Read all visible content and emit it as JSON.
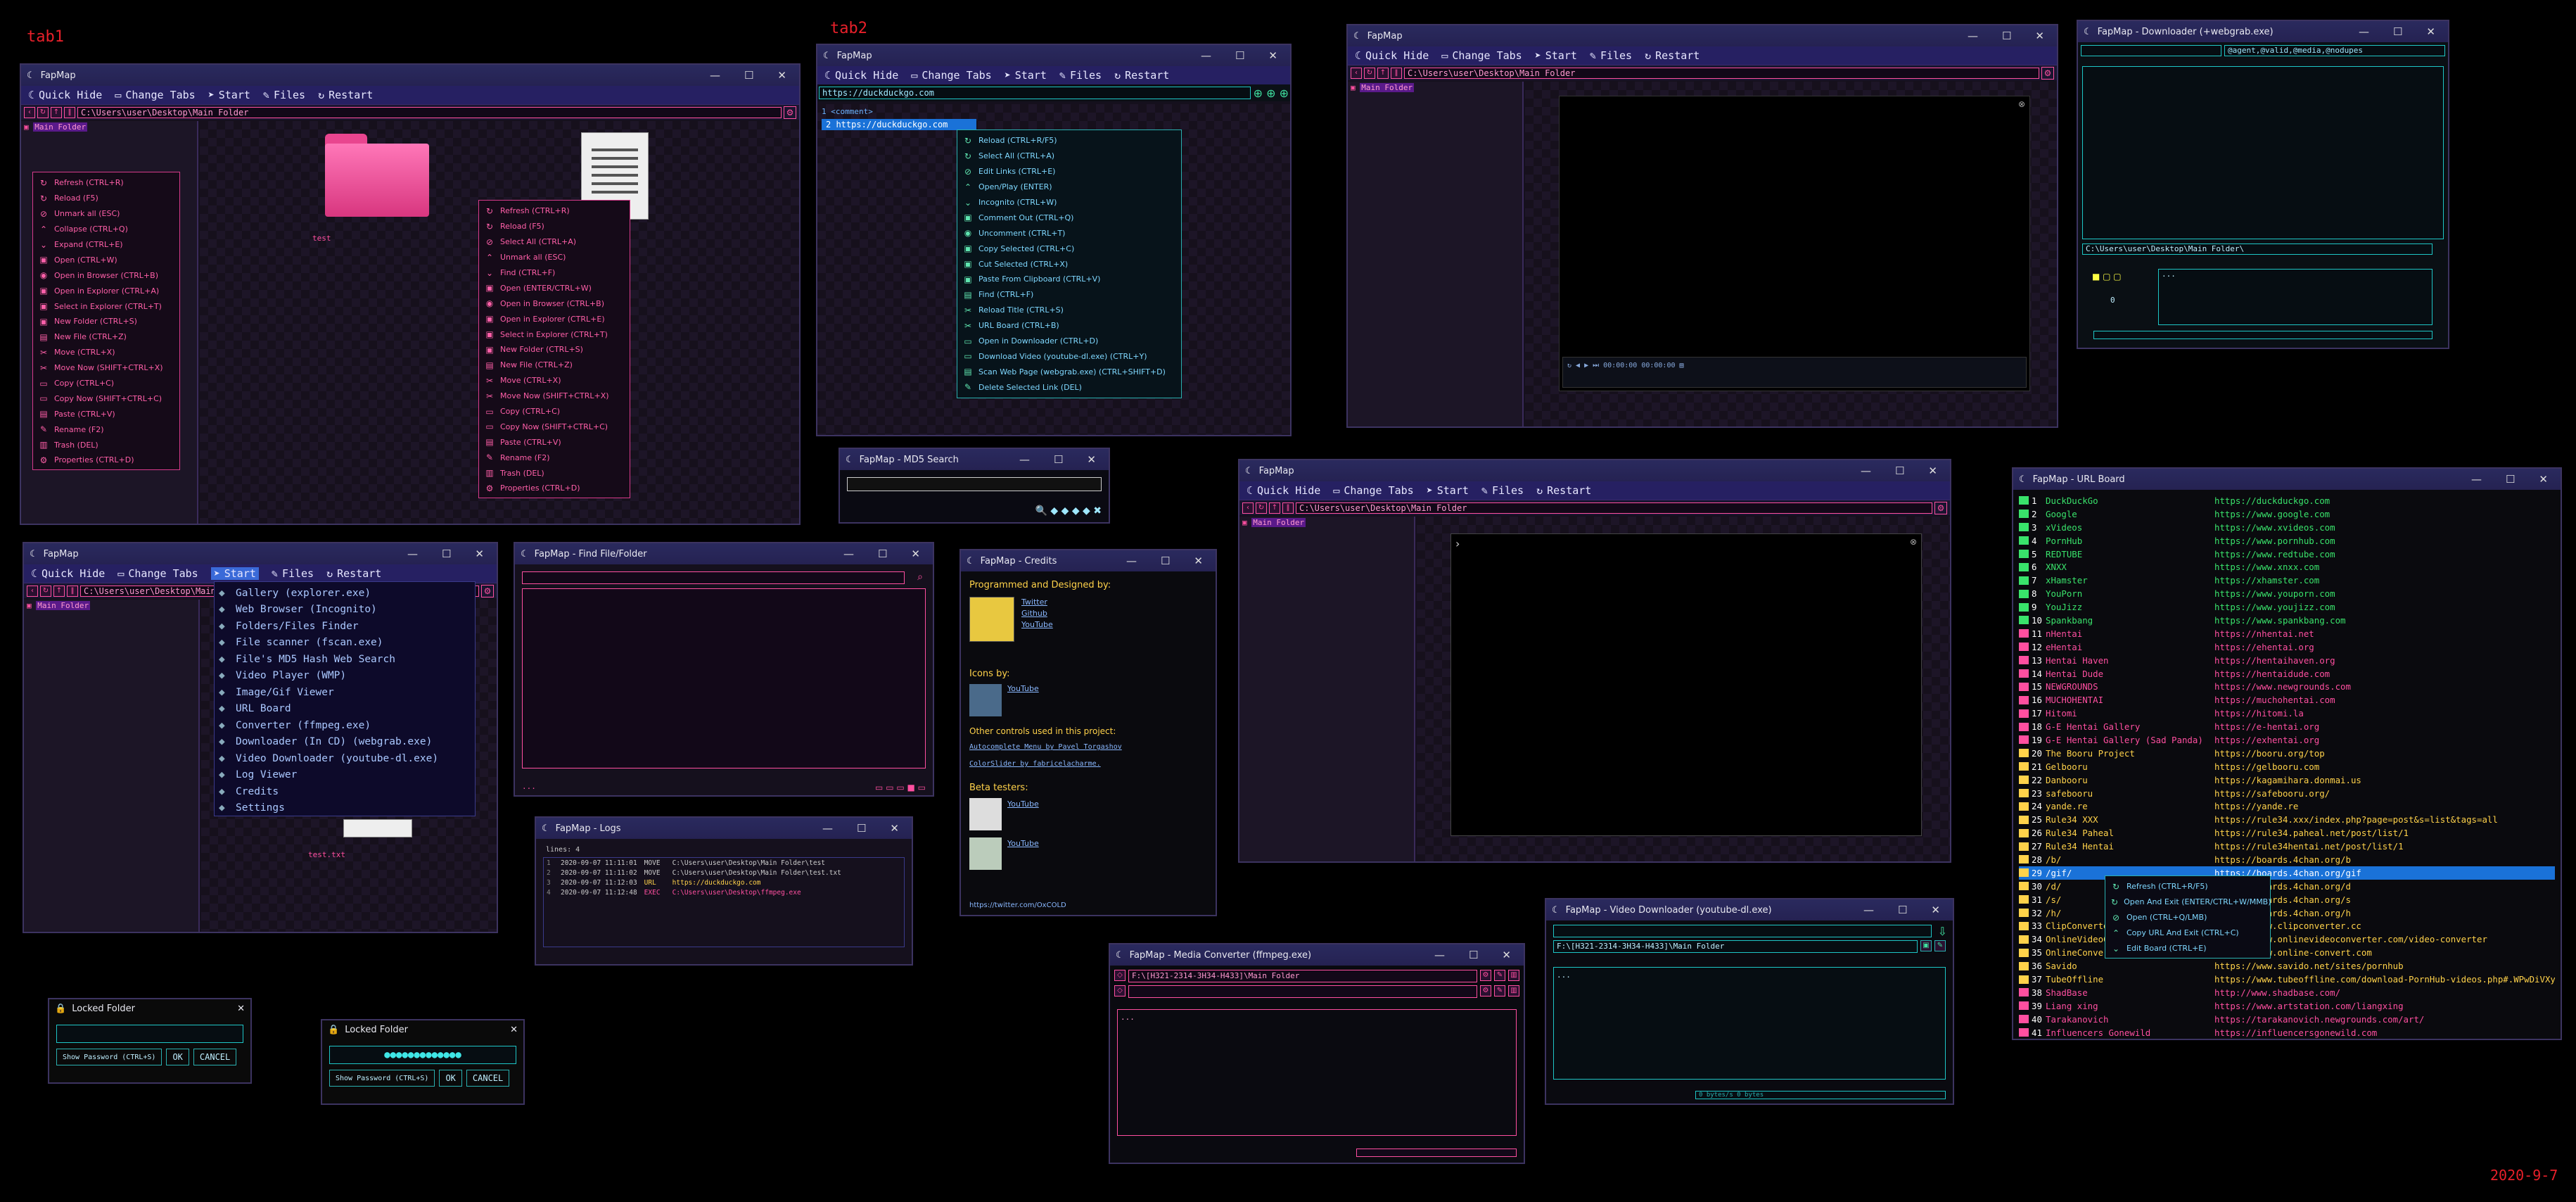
{
  "labels": {
    "tab1": "tab1",
    "tab2": "tab2",
    "date": "2020-9-7"
  },
  "app": "FapMap",
  "menu": {
    "quick_hide": "Quick Hide",
    "change_tabs": "Change Tabs",
    "start": "Start",
    "files": "Files",
    "restart": "Restart"
  },
  "path_main": "C:\\Users\\user\\Desktop\\Main Folder",
  "tree_main": "Main Folder",
  "explorer1": {
    "folder_label": "test",
    "ctx_left": [
      "Refresh (CTRL+R)",
      "Reload (F5)",
      "Unmark all (ESC)",
      "Collapse (CTRL+Q)",
      "Expand (CTRL+E)",
      "Open (CTRL+W)",
      "Open in Browser (CTRL+B)",
      "Open in Explorer (CTRL+A)",
      "Select in Explorer (CTRL+T)",
      "New Folder (CTRL+S)",
      "New File (CTRL+Z)",
      "Move (CTRL+X)",
      "Move Now (SHIFT+CTRL+X)",
      "Copy (CTRL+C)",
      "Copy Now (SHIFT+CTRL+C)",
      "Paste (CTRL+V)",
      "Rename (F2)",
      "Trash (DEL)",
      "Properties (CTRL+D)"
    ],
    "ctx_right": [
      "Refresh (CTRL+R)",
      "Reload (F5)",
      "Select All (CTRL+A)",
      "Unmark all (ESC)",
      "Find (CTRL+F)",
      "Open (ENTER/CTRL+W)",
      "Open in Browser (CTRL+B)",
      "Open in Explorer (CTRL+E)",
      "Select in Explorer (CTRL+T)",
      "New Folder (CTRL+S)",
      "New File (CTRL+Z)",
      "Move (CTRL+X)",
      "Move Now (SHIFT+CTRL+X)",
      "Copy (CTRL+C)",
      "Copy Now (SHIFT+CTRL+C)",
      "Paste (CTRL+V)",
      "Rename (F2)",
      "Trash (DEL)",
      "Properties (CTRL+D)"
    ]
  },
  "browser2": {
    "url": "https://duckduckgo.com",
    "line1": "1  <comment>",
    "line2": "2  https://duckduckgo.com",
    "ctx": [
      "Reload (CTRL+R/F5)",
      "Select All (CTRL+A)",
      "Edit Links (CTRL+E)",
      "Open/Play (ENTER)",
      "Incognito (CTRL+W)",
      "Comment Out (CTRL+Q)",
      "Uncomment (CTRL+T)",
      "Copy Selected (CTRL+C)",
      "Cut Selected (CTRL+X)",
      "Paste From Clipboard (CTRL+V)",
      "Find (CTRL+F)",
      "Reload Title (CTRL+S)",
      "URL Board (CTRL+B)",
      "Open in Downloader (CTRL+D)",
      "Download Video (youtube-dl.exe) (CTRL+Y)",
      "Scan Web Page (webgrab.exe) (CTRL+SHIFT+D)",
      "Delete Selected Link (DEL)"
    ]
  },
  "downloader": {
    "title": "FapMap - Downloader (+webgrab.exe)",
    "filter": "@agent,@valid,@media,@nodupes",
    "path": "C:\\Users\\user\\Desktop\\Main Folder\\",
    "count": "0",
    "dots": "..."
  },
  "md5": {
    "title": "FapMap - MD5 Search"
  },
  "start_menu": [
    "Gallery (explorer.exe)",
    "Web Browser (Incognito)",
    "Folders/Files Finder",
    "File scanner (fscan.exe)",
    "File's MD5 Hash Web Search",
    "Video Player (WMP)",
    "Image/Gif Viewer",
    "URL Board",
    "Converter (ffmpeg.exe)",
    "Downloader (In CD) (webgrab.exe)",
    "Video Downloader (youtube-dl.exe)",
    "Log Viewer",
    "Credits",
    "Settings"
  ],
  "start_folder_label": "test.txt",
  "find": {
    "title": "FapMap - Find File/Folder",
    "dots": "..."
  },
  "credits": {
    "title": "FapMap - Credits",
    "programmed": "Programmed and Designed by:",
    "links1": [
      "Twitter",
      "Github",
      "YouTube"
    ],
    "icons_by": "Icons by:",
    "links2": [
      "YouTube"
    ],
    "other": "Other controls used in this project:",
    "ctrl1": "Autocomplete Menu by Pavel Torgashov",
    "ctrl2": "ColorSlider by fabricelacharme.",
    "beta": "Beta testers:",
    "beta_links": [
      "YouTube",
      "YouTube"
    ],
    "footer": "https://twitter.com/OxCOLD"
  },
  "logs": {
    "title": "FapMap - Logs",
    "lines_label": "lines: 4",
    "rows": [
      {
        "n": "1",
        "t": "2020-09-07 11:11:01",
        "k": "MOVE",
        "p": "C:\\Users\\user\\Desktop\\Main Folder\\test"
      },
      {
        "n": "2",
        "t": "2020-09-07 11:11:02",
        "k": "MOVE",
        "p": "C:\\Users\\user\\Desktop\\Main Folder\\test.txt"
      },
      {
        "n": "3",
        "t": "2020-09-07 11:12:03",
        "k": "URL",
        "p": "https://duckduckgo.com"
      },
      {
        "n": "4",
        "t": "2020-09-07 11:12:48",
        "k": "EXEC",
        "p": "C:\\Users\\user\\Desktop\\ffmpeg.exe"
      }
    ]
  },
  "locked": {
    "title": "Locked Folder",
    "show_pw": "Show Password (CTRL+S)",
    "ok": "OK",
    "cancel": "CANCEL",
    "dots": "●●●●●●●●●●●●●"
  },
  "converter": {
    "title": "FapMap - Media Converter (ffmpeg.exe)",
    "path1": "F:\\[H321-2314-3H34-H433]\\Main Folder",
    "dots": "..."
  },
  "ytdl": {
    "title": "FapMap - Video Downloader (youtube-dl.exe)",
    "path": "F:\\[H321-2314-3H34-H433]\\Main Folder",
    "dots": "...",
    "status": "0 bytes/s  0 bytes"
  },
  "urlboard": {
    "title": "FapMap - URL Board",
    "rows": [
      {
        "n": "1",
        "l": "DuckDuckGo",
        "u": "https://duckduckgo.com",
        "c": "#39e36b"
      },
      {
        "n": "2",
        "l": "Google",
        "u": "https://www.google.com",
        "c": "#39e36b"
      },
      {
        "n": "3",
        "l": "xVideos",
        "u": "https://www.xvideos.com",
        "c": "#39e36b"
      },
      {
        "n": "4",
        "l": "PornHub",
        "u": "https://www.pornhub.com",
        "c": "#39e36b"
      },
      {
        "n": "5",
        "l": "REDTUBE",
        "u": "https://www.redtube.com",
        "c": "#39e36b"
      },
      {
        "n": "6",
        "l": "XNXX",
        "u": "https://www.xnxx.com",
        "c": "#39e36b"
      },
      {
        "n": "7",
        "l": "xHamster",
        "u": "https://xhamster.com",
        "c": "#39e36b"
      },
      {
        "n": "8",
        "l": "YouPorn",
        "u": "https://www.youporn.com",
        "c": "#39e36b"
      },
      {
        "n": "9",
        "l": "YouJizz",
        "u": "https://www.youjizz.com",
        "c": "#39e36b"
      },
      {
        "n": "10",
        "l": "Spankbang",
        "u": "https://www.spankbang.com",
        "c": "#39e36b"
      },
      {
        "n": "11",
        "l": "nHentai",
        "u": "https://nhentai.net",
        "c": "#ff4fa0"
      },
      {
        "n": "12",
        "l": "eHentai",
        "u": "https://ehentai.org",
        "c": "#ff4fa0"
      },
      {
        "n": "13",
        "l": "Hentai Haven",
        "u": "https://hentaihaven.org",
        "c": "#ff4fa0"
      },
      {
        "n": "14",
        "l": "Hentai Dude",
        "u": "https://hentaidude.com",
        "c": "#ff4fa0"
      },
      {
        "n": "15",
        "l": "NEWGROUNDS",
        "u": "https://www.newgrounds.com",
        "c": "#ff4fa0"
      },
      {
        "n": "16",
        "l": "MUCHOHENTAI",
        "u": "https://muchohentai.com",
        "c": "#ff4fa0"
      },
      {
        "n": "17",
        "l": "Hitomi",
        "u": "https://hitomi.la",
        "c": "#ff4fa0"
      },
      {
        "n": "18",
        "l": "G-E Hentai Gallery",
        "u": "https://e-hentai.org",
        "c": "#ff4fa0"
      },
      {
        "n": "19",
        "l": "G-E Hentai Gallery (Sad Panda)",
        "u": "https://exhentai.org",
        "c": "#ff4fa0"
      },
      {
        "n": "20",
        "l": "The Booru Project",
        "u": "https://booru.org/top",
        "c": "#ffd24a"
      },
      {
        "n": "21",
        "l": "Gelbooru",
        "u": "https://gelbooru.com",
        "c": "#ffd24a"
      },
      {
        "n": "22",
        "l": "Danbooru",
        "u": "https://kagamihara.donmai.us",
        "c": "#ffd24a"
      },
      {
        "n": "23",
        "l": "safebooru",
        "u": "https://safebooru.org/",
        "c": "#ffd24a"
      },
      {
        "n": "24",
        "l": "yande.re",
        "u": "https://yande.re",
        "c": "#ffd24a"
      },
      {
        "n": "25",
        "l": "Rule34 XXX",
        "u": "https://rule34.xxx/index.php?page=post&s=list&tags=all",
        "c": "#ffd24a"
      },
      {
        "n": "26",
        "l": "Rule34 Paheal",
        "u": "https://rule34.paheal.net/post/list/1",
        "c": "#ffd24a"
      },
      {
        "n": "27",
        "l": "Rule34 Hentai",
        "u": "https://rule34hentai.net/post/list/1",
        "c": "#ffd24a"
      },
      {
        "n": "28",
        "l": "/b/",
        "u": "https://boards.4chan.org/b",
        "c": "#ffd24a"
      },
      {
        "n": "29",
        "l": "/gif/",
        "u": "https://boards.4chan.org/gif",
        "c": "#ffd24a"
      },
      {
        "n": "30",
        "l": "/d/",
        "u": "https://boards.4chan.org/d",
        "c": "#ffd24a"
      },
      {
        "n": "31",
        "l": "/s/",
        "u": "https://boards.4chan.org/s",
        "c": "#ffd24a"
      },
      {
        "n": "32",
        "l": "/h/",
        "u": "https://boards.4chan.org/h",
        "c": "#ffd24a"
      },
      {
        "n": "33",
        "l": "ClipConverter",
        "u": "https://www.clipconverter.cc",
        "c": "#ffd24a"
      },
      {
        "n": "34",
        "l": "OnlineVideoConverter",
        "u": "https://www.onlinevideoconverter.com/video-converter",
        "c": "#ffd24a"
      },
      {
        "n": "35",
        "l": "OnlineConvertFree",
        "u": "https://www.online-convert.com",
        "c": "#ffd24a"
      },
      {
        "n": "36",
        "l": "Savido",
        "u": "https://www.savido.net/sites/pornhub",
        "c": "#ffd24a"
      },
      {
        "n": "37",
        "l": "TubeOffline",
        "u": "https://www.tubeoffline.com/download-PornHub-videos.php#.WPwDiVXyuUl",
        "c": "#ffd24a"
      },
      {
        "n": "38",
        "l": "ShadBase",
        "u": "http://www.shadbase.com/",
        "c": "#ff4fa0"
      },
      {
        "n": "39",
        "l": "Liang xing",
        "u": "https://www.artstation.com/liangxing",
        "c": "#ff4fa0"
      },
      {
        "n": "40",
        "l": "Tarakanovich",
        "u": "https://tarakanovich.newgrounds.com/art/",
        "c": "#ff4fa0"
      },
      {
        "n": "41",
        "l": "Influencers Gonewild",
        "u": "https://influencersgonewild.com",
        "c": "#ff4fa0"
      }
    ],
    "ctx": [
      "Refresh (CTRL+R/F5)",
      "Open And Exit (ENTER/CTRL+W/MMB)",
      "Open (CTRL+Q/LMB)",
      "Copy URL And Exit (CTRL+C)",
      "Edit Board (CTRL+E)"
    ]
  }
}
